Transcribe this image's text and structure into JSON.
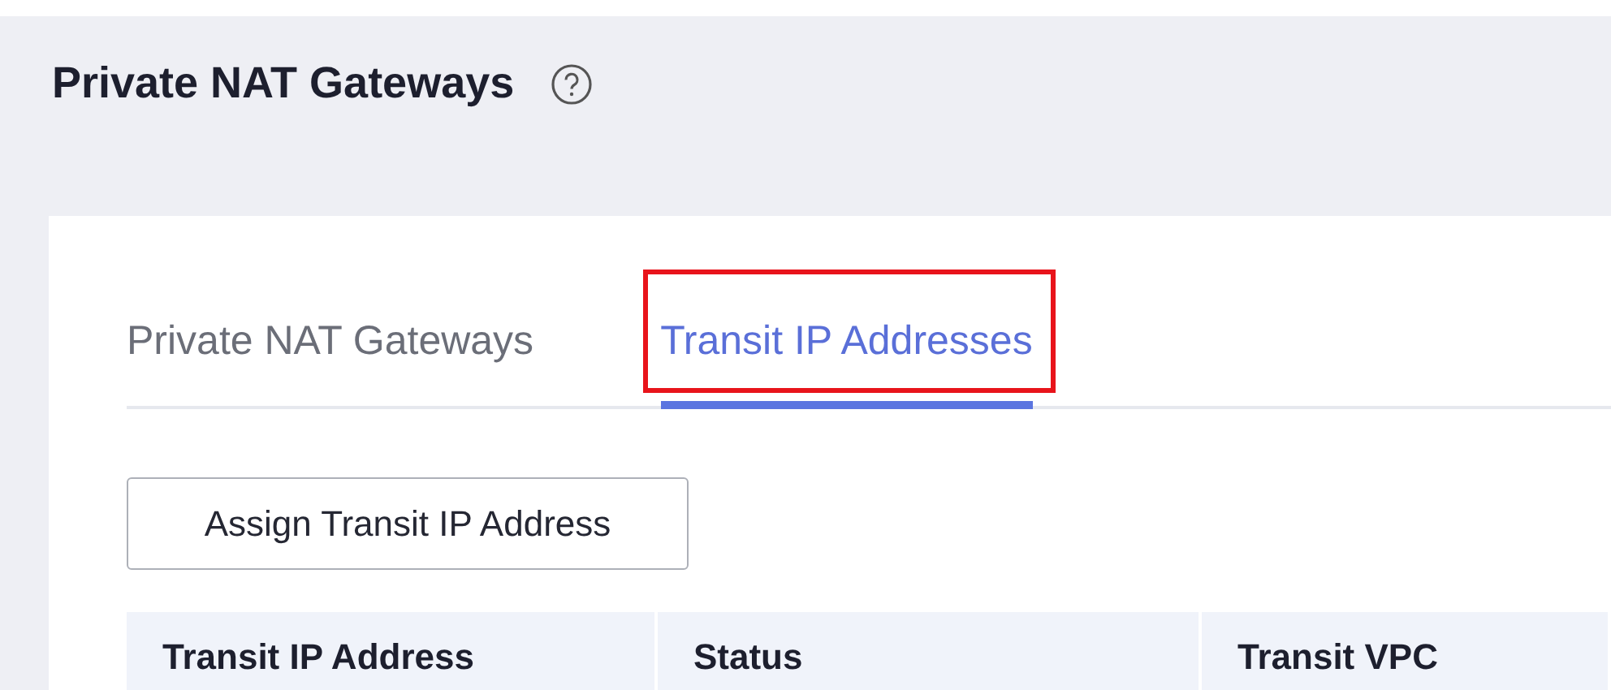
{
  "page": {
    "title": "Private NAT Gateways"
  },
  "tabs": [
    {
      "label": "Private NAT Gateways",
      "selected": false,
      "highlighted": false
    },
    {
      "label": "Transit IP Addresses",
      "selected": true,
      "highlighted": true
    }
  ],
  "toolbar": {
    "buttons": [
      "Assign Transit IP Address"
    ]
  },
  "table": {
    "columns": [
      "Transit IP Address",
      "Status",
      "Transit VPC"
    ]
  }
}
